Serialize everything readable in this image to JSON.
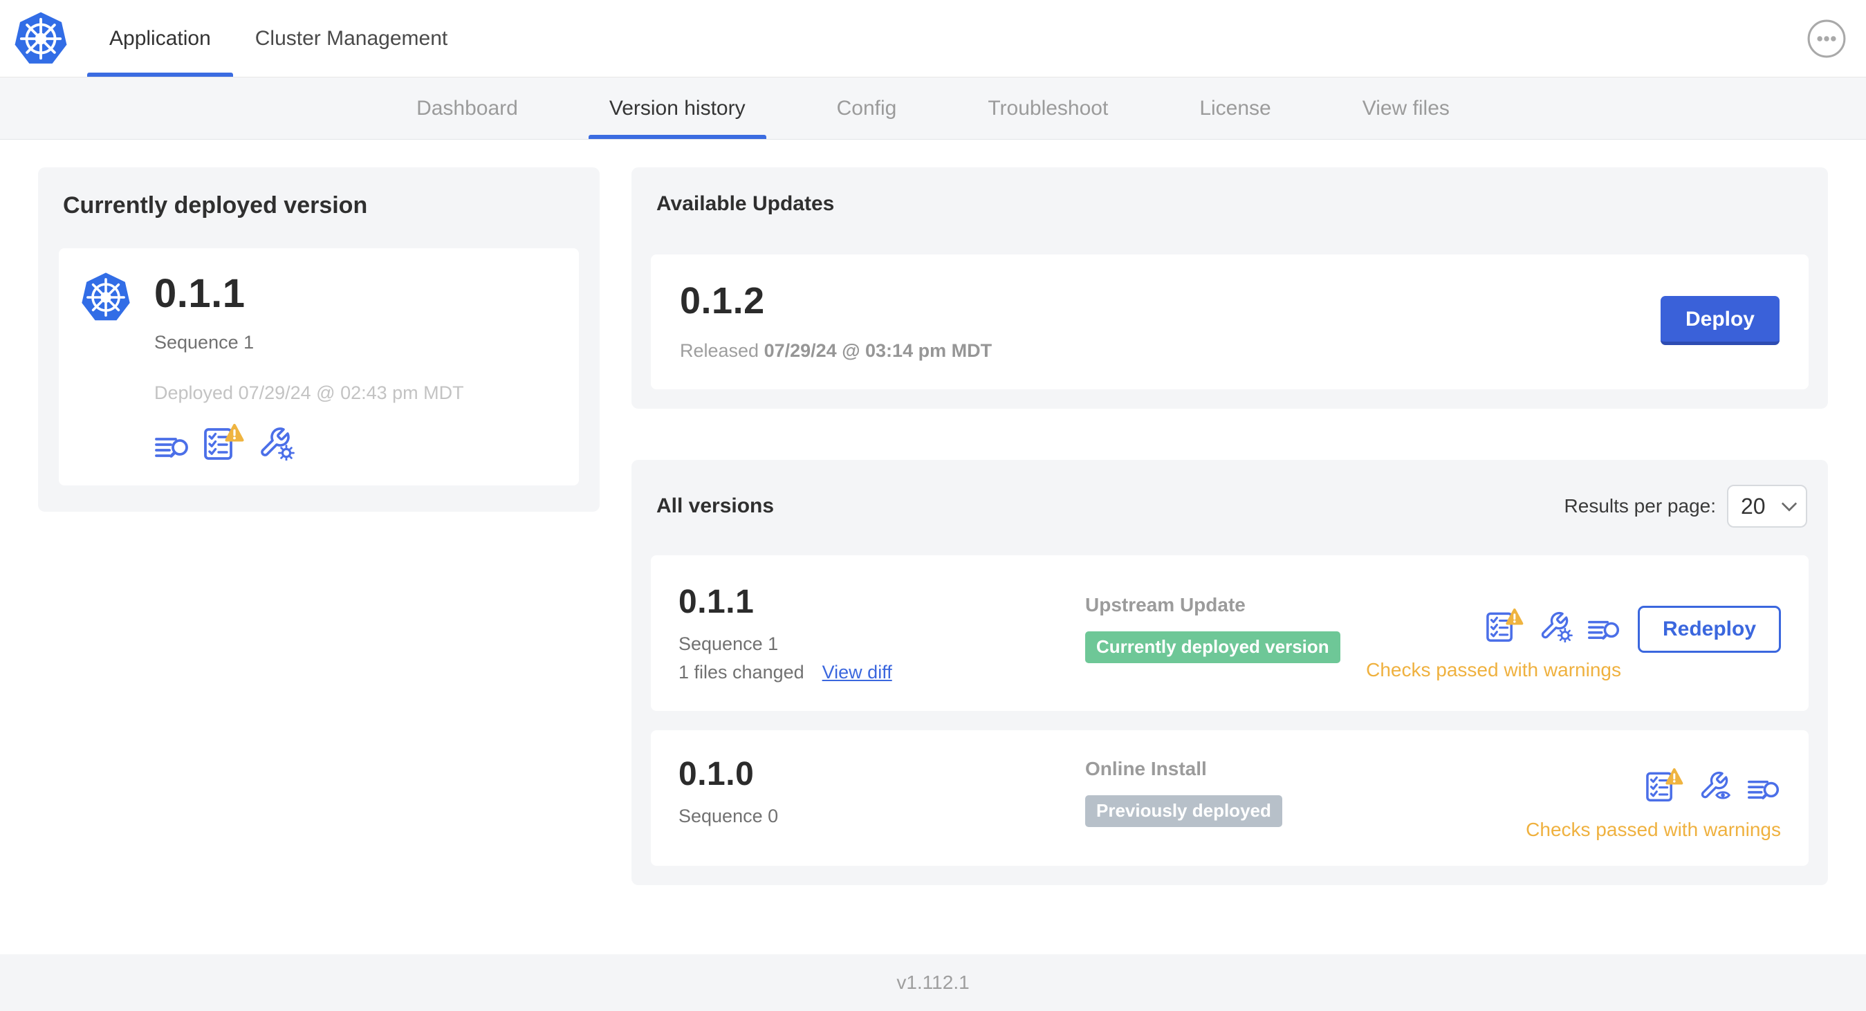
{
  "header": {
    "logo_icon": "kubernetes-logo",
    "app_tab": "Application",
    "cluster_tab": "Cluster Management",
    "menu_icon": "ellipsis-menu-icon"
  },
  "subnav": {
    "active": "Version history",
    "items": [
      {
        "label": "Dashboard"
      },
      {
        "label": "Version history"
      },
      {
        "label": "Config"
      },
      {
        "label": "Troubleshoot"
      },
      {
        "label": "License"
      },
      {
        "label": "View files"
      }
    ]
  },
  "current": {
    "title": "Currently deployed version",
    "version": "0.1.1",
    "sequence": "Sequence 1",
    "deployed": "Deployed 07/29/24 @ 02:43 pm MDT",
    "icons": [
      "release-diff-icon",
      "preflight-checks-warning-icon",
      "config-wrench-gear-icon"
    ]
  },
  "available": {
    "title": "Available Updates",
    "version": "0.1.2",
    "released_label": "Released",
    "released_value": "07/29/24 @ 03:14 pm MDT",
    "deploy_label": "Deploy"
  },
  "all_versions": {
    "title": "All versions",
    "per_page_label": "Results per page:",
    "per_page_value": "20",
    "rows": [
      {
        "version": "0.1.1",
        "sequence": "Sequence 1",
        "files_changed": "1 files changed",
        "diff_link": "View diff",
        "source": "Upstream Update",
        "badge": "Currently deployed version",
        "badge_color": "#6ec797",
        "icons": [
          "preflight-checks-warning-icon",
          "config-wrench-gear-icon",
          "release-diff-icon"
        ],
        "checks_status": "Checks passed with warnings",
        "action": "Redeploy"
      },
      {
        "version": "0.1.0",
        "sequence": "Sequence 0",
        "source": "Online Install",
        "badge": "Previously deployed",
        "badge_color": "#b7c0c9",
        "icons": [
          "preflight-checks-warning-icon",
          "config-wrench-eye-icon",
          "release-diff-icon"
        ],
        "checks_status": "Checks passed with warnings"
      }
    ]
  },
  "footer": {
    "app_version": "v1.112.1"
  },
  "colors": {
    "accent_blue": "#3b6ce1",
    "kubernetes_blue": "#326de6",
    "icon_blue": "#4b6fe8",
    "warning_amber": "#efb13f",
    "badge_green": "#6ec797",
    "badge_gray": "#b7c0c9",
    "card_gray": "#f4f5f7"
  }
}
